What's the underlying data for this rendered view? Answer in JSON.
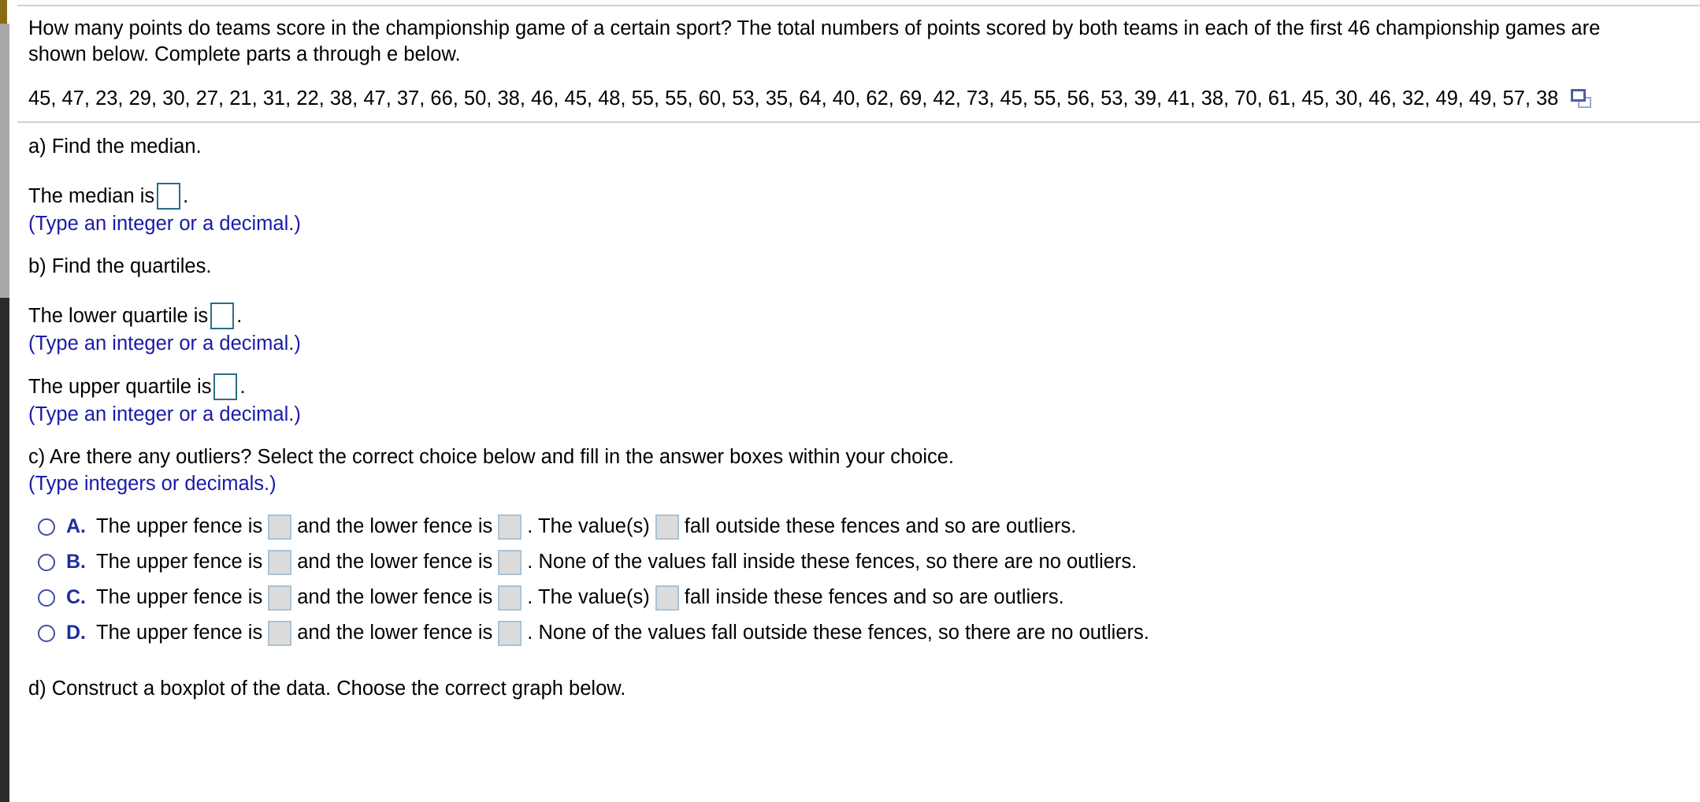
{
  "problem": {
    "intro": "How many points do teams score in the championship game of a certain sport? The total numbers of points scored by both teams in each of the first 46 championship games are shown below. Complete parts a through e below.",
    "data_values_text": "45, 47, 23, 29, 30, 27, 21, 31, 22, 38, 47, 37, 66, 50, 38, 46, 45, 48, 55, 55, 60, 53, 35, 64, 40, 62, 69, 42, 73, 45, 55, 56, 53, 39, 41, 38, 70, 61, 45, 30, 46, 32, 49, 49, 57, 38",
    "data_values": [
      45,
      47,
      23,
      29,
      30,
      27,
      21,
      31,
      22,
      38,
      47,
      37,
      66,
      50,
      38,
      46,
      45,
      48,
      55,
      55,
      60,
      53,
      35,
      64,
      40,
      62,
      69,
      42,
      73,
      45,
      55,
      56,
      53,
      39,
      41,
      38,
      70,
      61,
      45,
      30,
      46,
      32,
      49,
      49,
      57,
      38
    ],
    "copy_icon": "copy-icon"
  },
  "part_a": {
    "heading": "a) Find the median.",
    "answer_prefix": "The median is",
    "answer_suffix": ".",
    "answer_value": "",
    "hint": "(Type an integer or a decimal.)"
  },
  "part_b": {
    "heading": "b) Find the quartiles.",
    "lower_prefix": "The lower quartile is",
    "lower_suffix": ".",
    "lower_value": "",
    "lower_hint": "(Type an integer or a decimal.)",
    "upper_prefix": "The upper quartile is",
    "upper_suffix": ".",
    "upper_value": "",
    "upper_hint": "(Type an integer or a decimal.)"
  },
  "part_c": {
    "heading": "c) Are there any outliers? Select the correct choice below and fill in the answer boxes within your choice.",
    "hint": "(Type integers or decimals.)",
    "choices": [
      {
        "letter": "A.",
        "selected": false,
        "seg1": "The upper fence is",
        "seg2": "and the lower fence is",
        "seg3": ". The value(s)",
        "seg4": "fall outside these fences and so are outliers.",
        "box1": "",
        "box2": "",
        "box3": "",
        "box_count": 3
      },
      {
        "letter": "B.",
        "selected": false,
        "seg1": "The upper fence is",
        "seg2": "and the lower fence is",
        "seg3": ". None of the values fall inside these fences, so there are no outliers.",
        "seg4": "",
        "box1": "",
        "box2": "",
        "box3": "",
        "box_count": 2
      },
      {
        "letter": "C.",
        "selected": false,
        "seg1": "The upper fence is",
        "seg2": "and the lower fence is",
        "seg3": ". The value(s)",
        "seg4": "fall inside these fences and so are outliers.",
        "box1": "",
        "box2": "",
        "box3": "",
        "box_count": 3
      },
      {
        "letter": "D.",
        "selected": false,
        "seg1": "The upper fence is",
        "seg2": "and the lower fence is",
        "seg3": ". None of the values fall outside these fences, so there are no outliers.",
        "seg4": "",
        "box1": "",
        "box2": "",
        "box3": "",
        "box_count": 2
      }
    ]
  },
  "part_d": {
    "heading": "d) Construct a boxplot of the data. Choose the correct graph below."
  },
  "colors": {
    "hint_blue": "#1a1aa8",
    "choice_letter_blue": "#1c2f9e",
    "open_box_border": "#2a6e86",
    "fill_box_bg": "#dcdcdc",
    "fill_box_border": "#a9c3d6",
    "rule": "#c9d2dd",
    "copy_icon_front": "#4e5f9c",
    "copy_icon_back": "#9aa6cf"
  }
}
